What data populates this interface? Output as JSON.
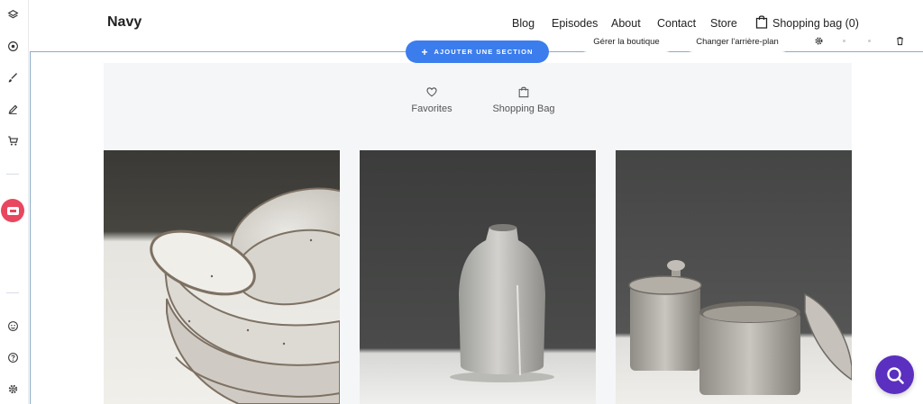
{
  "site": {
    "brand": "Navy",
    "nav": [
      "Blog",
      "Episodes",
      "About",
      "Contact",
      "Store"
    ],
    "bag_label": "Shopping bag (0)"
  },
  "editor": {
    "add_section_label": "AJOUTER UNE SECTION",
    "manage_store_label": "Gérer la boutique",
    "change_background_label": "Changer l'arrière-plan",
    "accent_color": "#3b7ded",
    "active_tool_color": "#e8475f"
  },
  "sidebar": {
    "tools": [
      "layers-icon",
      "target-icon",
      "brush-icon",
      "pen-icon",
      "cart-icon",
      "store-section-icon",
      "smile-icon",
      "help-icon",
      "settings-icon"
    ]
  },
  "shortcuts": [
    {
      "label": "Favorites",
      "icon": "heart-icon"
    },
    {
      "label": "Shopping Bag",
      "icon": "shopping-bag-icon"
    }
  ],
  "products": [
    {
      "name": "stacked-ceramic-bowls-image"
    },
    {
      "name": "ceramic-bottle-vase-image"
    },
    {
      "name": "ceramic-lidded-jars-image"
    }
  ],
  "chat": {
    "icon": "search-icon",
    "color": "#5b2fbf"
  }
}
